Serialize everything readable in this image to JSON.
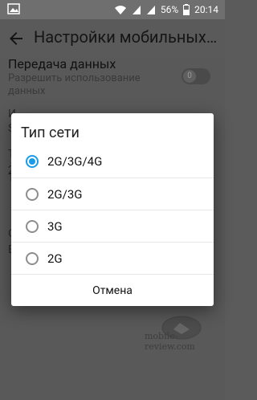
{
  "statusbar": {
    "battery": "56%",
    "time": "20:14",
    "icons": [
      "wifi-icon",
      "signal-icon",
      "signal-icon",
      "battery-icon"
    ]
  },
  "appbar": {
    "title": "Настройки мобильных с..."
  },
  "settings": {
    "data_title": "Передача данных",
    "data_summary": "Разрешить использование данных",
    "toggle_state": "0"
  },
  "dialog": {
    "title": "Тип сети",
    "options": [
      {
        "label": "2G/3G/4G",
        "selected": true
      },
      {
        "label": "2G/3G",
        "selected": false
      },
      {
        "label": "3G",
        "selected": false
      },
      {
        "label": "2G",
        "selected": false
      }
    ],
    "cancel_label": "Отмена"
  },
  "background_fragments": [
    "И",
    "S",
    "Т",
    "2",
    "Т",
    "С",
    "Е"
  ],
  "watermark": {
    "text": "mobile-review.com"
  },
  "colors": {
    "accent": "#1a9be9"
  }
}
